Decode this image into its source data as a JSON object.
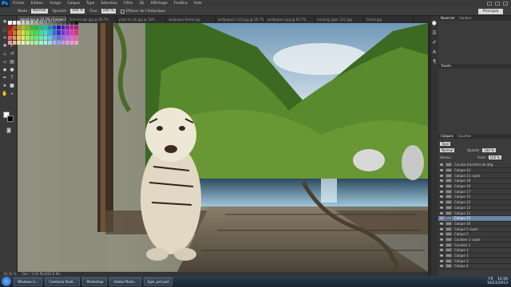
{
  "app": {
    "logo": "Ps"
  },
  "menu": [
    "Fichier",
    "Edition",
    "Image",
    "Calque",
    "Type",
    "Sélection",
    "Filtre",
    "3D",
    "Affichage",
    "Fenêtre",
    "Aide"
  ],
  "options": {
    "mode_label": "Mode :",
    "mode_value": "Normal",
    "opacity_label": "Opacité :",
    "opacity_value": "100 %",
    "flow_label": "Flux :",
    "flow_value": "100 %",
    "erase_history": "Effacer de l'historique",
    "workspace": "Principal"
  },
  "tabs": [
    "atpsd.jpg @ 33.3% (Calque 21, RVB/8)",
    "ScenicLake.jpg @ 66.7%",
    "pixel.ch_hk.jpg @ 50%",
    "wallpaper-fondo.jpg",
    "wallpapers (31).jpg @ 16.7%",
    "wallpapers.jpg @ 66.7%",
    "missing_tiger_101.jpg",
    "forest.jpg"
  ],
  "status": {
    "zoom": "33,33 %",
    "doc": "Doc : 5,93 Mo/283,6 Mo"
  },
  "panels": {
    "swatch_tabs": [
      "Nuancier",
      "Couleur"
    ],
    "adjust_tabs": [
      "Tracés"
    ],
    "layers_tabs": [
      "Calques",
      "Couches"
    ],
    "kind_label": "Type",
    "blend": "Normal",
    "opacity_label": "Opacité :",
    "opacity_value": "100 %",
    "lock_label": "Verrou :",
    "fill_label": "Fond :",
    "fill_value": "100 %"
  },
  "layers": [
    "Courbe transfert de dég.",
    "Calque 43",
    "Calque 21 copie",
    "Calque 18",
    "Calque 16",
    "Calque 17",
    "Calque 15",
    "Calque 22",
    "Calque 12",
    "Calque 11",
    "Calque 21",
    "Calque 10",
    "Calque 5 copie",
    "Calque 5",
    "Courbes 1 copie",
    "Courbes 1",
    "Calque 1",
    "Calque 2",
    "Calque 3",
    "Calque 4"
  ],
  "selected_layer_index": 10,
  "taskbar": {
    "buttons": [
      "Windows Li...",
      "Camtasia Studi...",
      "Photoshop",
      "Adobe Photo...",
      "tiger_psd.psd"
    ],
    "time": "14:26",
    "date": "16/12/2013",
    "lang": "FR"
  }
}
